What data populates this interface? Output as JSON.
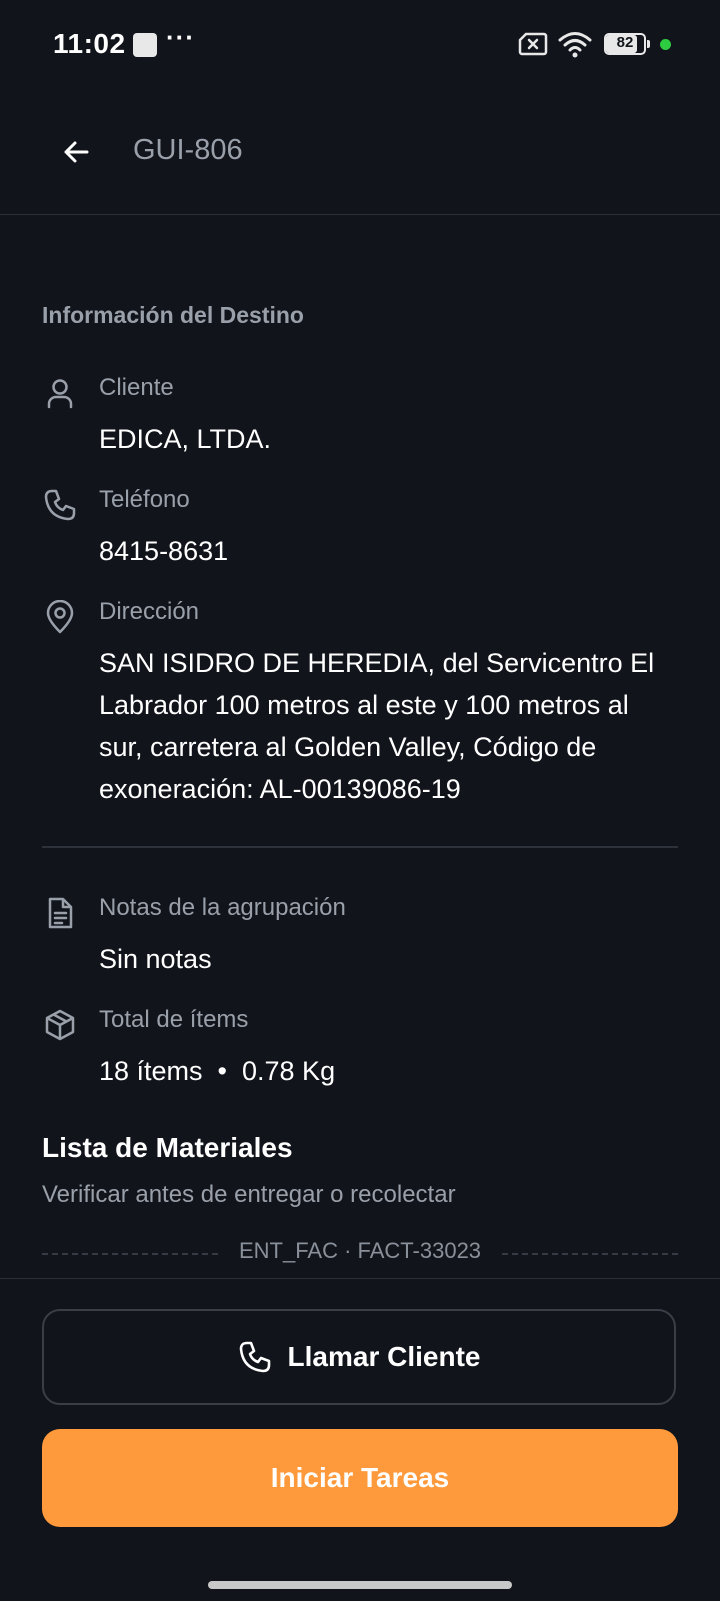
{
  "status_bar": {
    "time": "11:02",
    "dots": "···",
    "battery_level": "82",
    "battery_fraction": 0.82,
    "green_dot_color": "#2ecc40",
    "icons": [
      "square-notification-icon",
      "sim-x-icon",
      "wifi-icon",
      "battery-icon"
    ]
  },
  "app_bar": {
    "title": "GUI-806",
    "back_icon": "arrow-left-icon"
  },
  "destination": {
    "section_title": "Información del Destino",
    "client_label": "Cliente",
    "client_value": "EDICA, LTDA.",
    "phone_label": "Teléfono",
    "phone_value": "8415-8631",
    "address_label": "Dirección",
    "address_value": "SAN ISIDRO DE HEREDIA, del Servicentro El Labrador 100 metros al este y 100 metros al sur, carretera al Golden Valley, Código de exoneración: AL-00139086-19"
  },
  "grouping": {
    "notes_label": "Notas de la agrupación",
    "notes_value": "Sin notas",
    "items_label": "Total de ítems",
    "items_value": "18 ítems  •  0.78 Kg"
  },
  "materials": {
    "title": "Lista de Materiales",
    "subtitle": "Verificar antes de entregar o recolectar",
    "invoice_label": "ENT_FAC · FACT-33023"
  },
  "actions": {
    "call_label": "Llamar Cliente",
    "start_label": "Iniciar Tareas",
    "accent_color": "#ff9a3c"
  }
}
